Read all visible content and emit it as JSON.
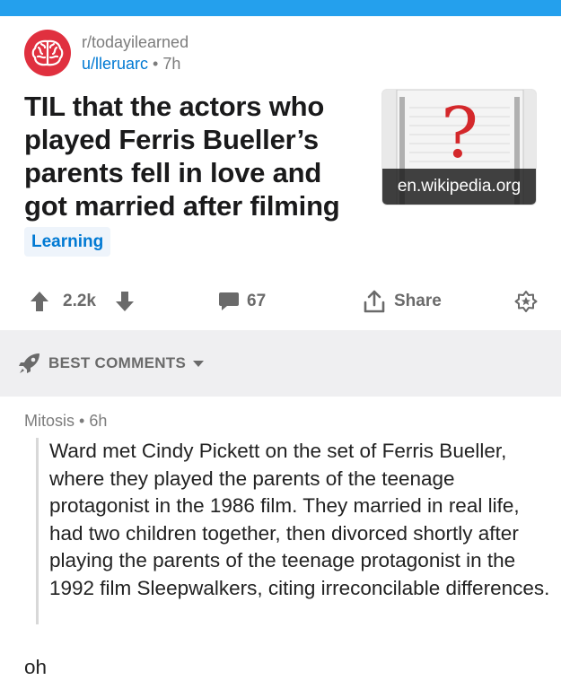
{
  "post": {
    "subreddit": "r/todayilearned",
    "author": "u/lleruarc",
    "separator": "•",
    "age": "7h",
    "title": "TIL that the actors who played Ferris Bueller’s parents fell in love and got married after filming",
    "thumbnail_domain": "en.wikipedia.org",
    "flair": "Learning"
  },
  "actions": {
    "score": "2.2k",
    "comments": "67",
    "share": "Share"
  },
  "sort": {
    "label": "BEST COMMENTS"
  },
  "comment": {
    "author": "Mitosis",
    "separator": "•",
    "age": "6h",
    "quote": "Ward met Cindy Pickett on the set of Ferris Bueller, where they played the parents of the teenage protagonist in the 1986 film. They married in real life, had two children together, then divorced shortly after playing the parents of the teenage protagonist in the 1992 film Sleepwalkers, citing irreconcilable differences.",
    "body": "oh"
  },
  "colors": {
    "header_bar": "#24a0ed",
    "subreddit_avatar": "#e0303f",
    "link": "#0079d3",
    "muted": "#7c7c7c",
    "sort_bar": "#efeff1"
  }
}
